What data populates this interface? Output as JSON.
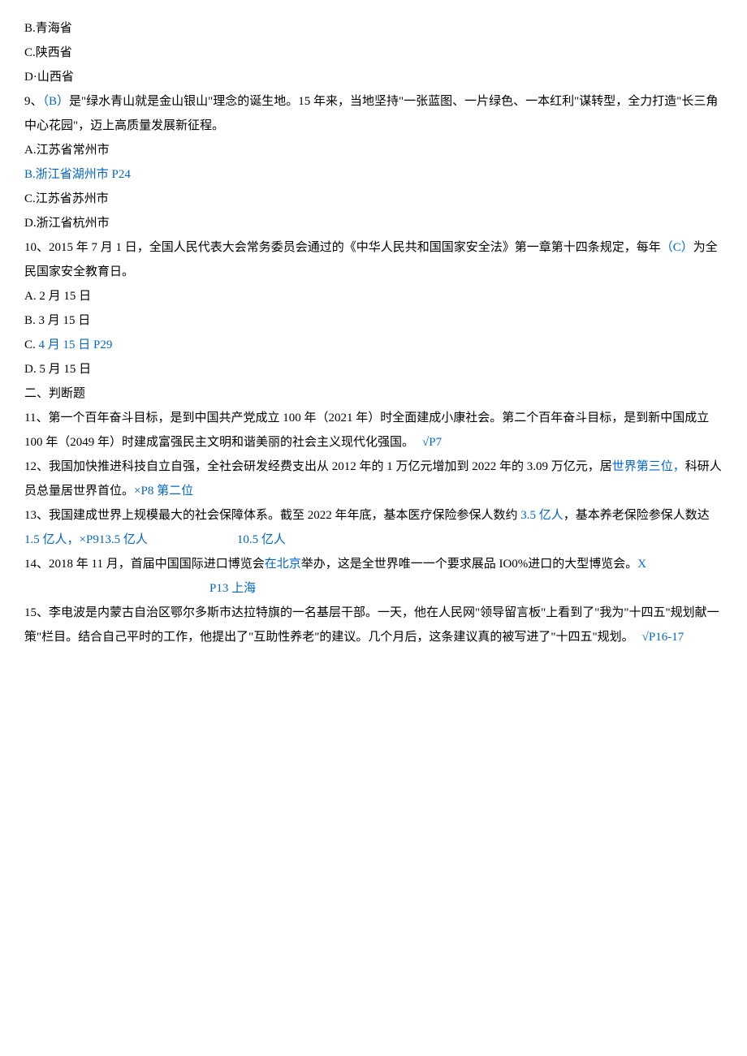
{
  "q8": {
    "optB": "B.青海省",
    "optC": "C.陕西省",
    "optD": "D·山西省"
  },
  "q9": {
    "stem_pre": "9、",
    "answer": "（B）",
    "stem_post": "是\"绿水青山就是金山银山\"理念的诞生地。15 年来，当地坚持\"一张蓝图、一片绿色、一本红利\"谋转型，全力打造\"长三角中心花园\"，迈上高质量发展新征程。",
    "optA": "A.江苏省常州市",
    "optB": "B.浙江省湖州市 P24",
    "optC": "C.江苏省苏州市",
    "optD": "D.浙江省杭州市"
  },
  "q10": {
    "stem_a": "10、2015 年 7 月 1 日，全国人民代表大会常务委员会通过的《中华人民共和国国家安全法》第一章第十四条规定，每年",
    "answer": "（C）",
    "stem_b": "为全民国家安全教育日。",
    "optA": "A.   2 月 15 日",
    "optB": "B.   3 月 15 日",
    "optC": "C.   ",
    "optC_blue": "4 月 15 日 P29",
    "optD": "D.   5 月 15 日"
  },
  "section2": "二、判断题",
  "q11": {
    "stem": "11、第一个百年奋斗目标，是到中国共产党成立 100 年（2021 年）时全面建成小康社会。第二个百年奋斗目标，是到新中国成立 100 年（2049 年）时建成富强民主文明和谐美丽的社会主义现代化强国。",
    "ans": "√P7"
  },
  "q12": {
    "stem": "12、我国加快推进科技自立自强，全社会研发经费支出从 2012 年的 1 万亿元增加到 2022 年的 3.09 万亿元，居",
    "blue_a": "世界第三位，",
    "stem_b": "科研人员总量居世界首位。",
    "blue_b": "×P8 第二位"
  },
  "q13": {
    "stem_a": "13、我国建成世界上规模最大的社会保障体系。截至 2022 年年底，基本医疗保险参保人数约 ",
    "blue_a": "3.5 亿人",
    "stem_b": "，基本养老保险参保人数达 ",
    "blue_b": "1.5 亿人，",
    "blue_c": "×P913.5 亿人",
    "blue_d": "10.5 亿人"
  },
  "q14": {
    "stem_a": "14、2018 年 11 月，首届中国国际进口博览会",
    "blue_a": "在北京",
    "stem_b": "举办，这是全世界唯一一个要求展品 IO0%进口的大型博览会。",
    "blue_b": "X",
    "blue_c": "P13 上海"
  },
  "q15": {
    "stem": "15、李电波是内蒙古自治区鄂尔多斯市达拉特旗的一名基层干部。一天，他在人民网\"领导留言板\"上看到了\"我为\"十四五\"规划献一策\"栏目。结合自己平时的工作，他提出了\"互助性养老\"的建议。几个月后，这条建议真的被写进了\"十四五\"规划。",
    "ans": "√P16-17"
  }
}
